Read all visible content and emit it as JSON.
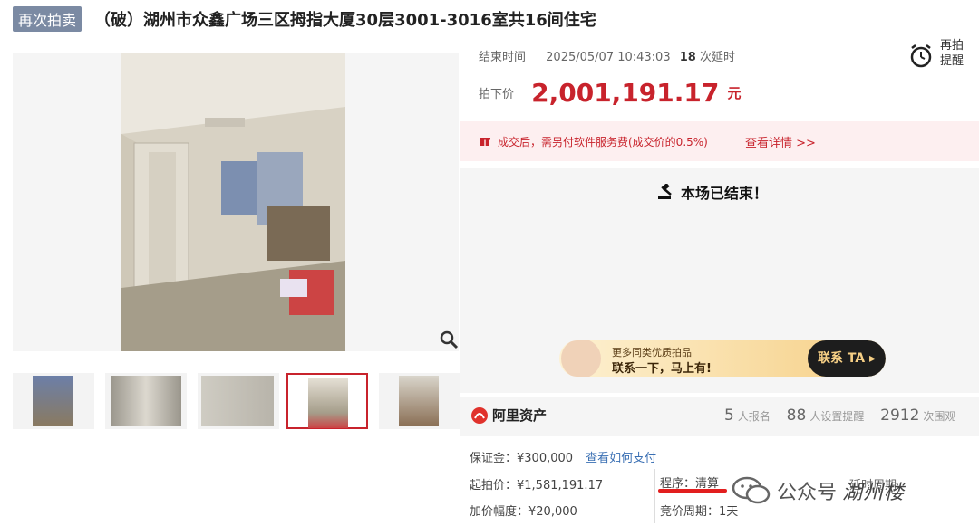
{
  "header": {
    "tag": "再次拍卖",
    "title": "（破）湖州市众鑫广场三区拇指大厦30层3001-3016室共16间住宅"
  },
  "auction": {
    "end_label": "结束时间",
    "end_time": "2025/05/07 10:43:03",
    "delay_count": "18",
    "delay_label": "次延时",
    "price_label": "拍下价",
    "price": "2,001,191.17",
    "price_unit": "元",
    "remind_label_1": "再拍",
    "remind_label_2": "提醒"
  },
  "notice": {
    "text": "成交后，需另付软件服务费(成交价的0.5%)",
    "link": "查看详情 >>"
  },
  "status": {
    "text": "本场已结束！"
  },
  "banner": {
    "line1": "更多同类优质拍品",
    "line2": "联系一下，马上有!",
    "cta": "联系 TA ▸"
  },
  "ali": {
    "logo_text": "阿里资产",
    "signup_count": "5",
    "signup_label": "人报名",
    "remind_count": "88",
    "remind_label": "人设置提醒",
    "view_count": "2912",
    "view_label": "次围观"
  },
  "details": {
    "deposit": "保证金：¥300,000",
    "pay_link": "查看如何支付",
    "start_price": "起拍价：¥1,581,191.17",
    "increment": "加价幅度：¥20,000",
    "procedure": "程序：清算",
    "period": "竞价周期：1天",
    "delay_period": "延时周期",
    "watermark_1": "公众号",
    "watermark_2": "湖州楼"
  },
  "colors": {
    "accent_red": "#c8232c",
    "tag_bg": "#7b8aa3",
    "link_blue": "#3a6fb3"
  }
}
